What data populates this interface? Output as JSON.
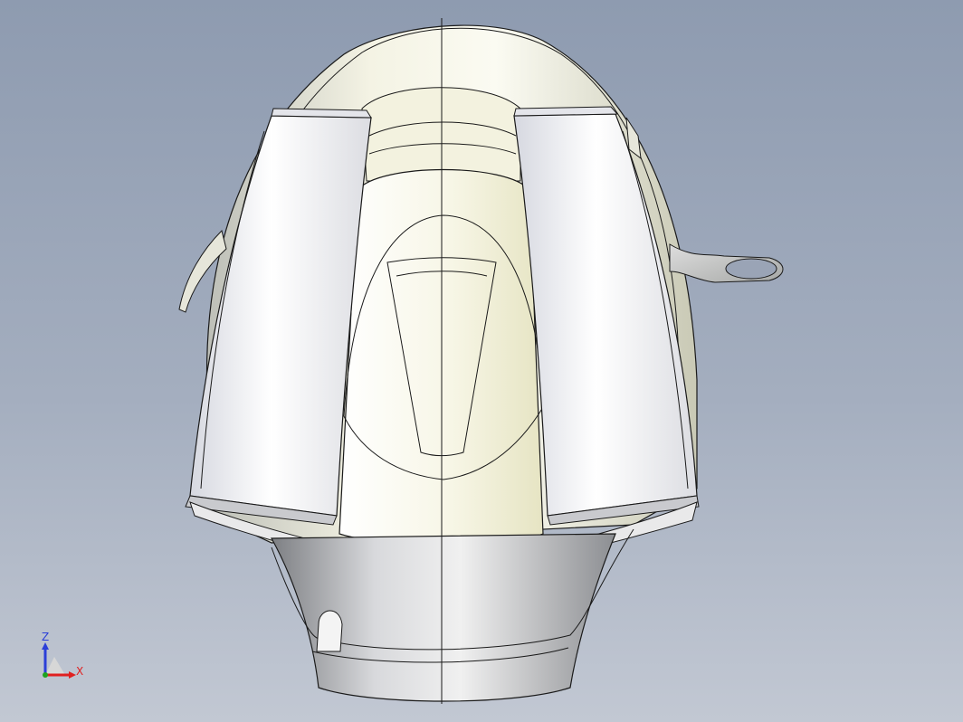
{
  "viewport": {
    "background_top": "#8e9bb0",
    "background_bottom": "#c2c8d3"
  },
  "model": {
    "description_icon": "cad-3d-model",
    "edge_color": "#1a1a1a",
    "shade_light": "#ffffff",
    "shade_mid": "#e2e3dc",
    "shade_dark": "#8a8c8a",
    "tint": "#f0efd2"
  },
  "triad": {
    "z_label": "Z",
    "x_label": "X",
    "z_color": "#2b3fd8",
    "x_color": "#e02020",
    "y_color": "#1fa31f"
  }
}
